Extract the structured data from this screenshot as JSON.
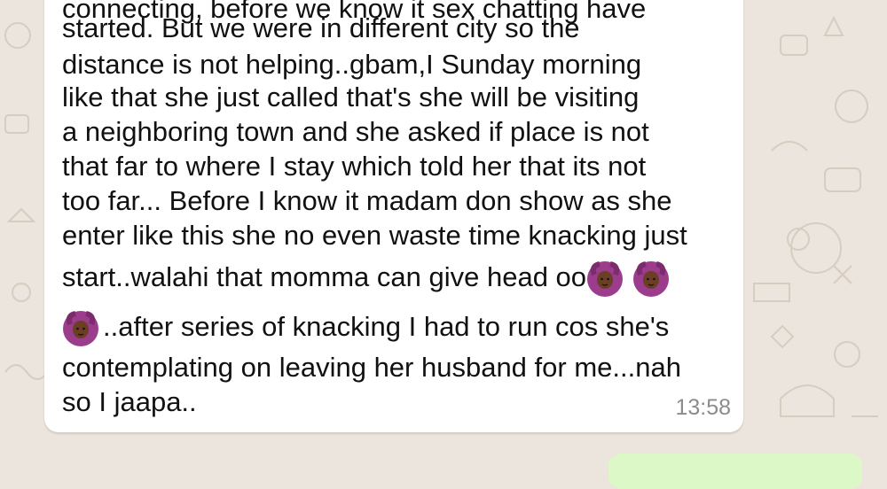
{
  "message": {
    "lines": [
      "connecting, before we know it sex chatting have",
      "started. But we were in different city so the",
      "distance is not helping..gbam,I Sunday morning",
      "like that she just called that's she will be visiting",
      "a neighboring town and she asked if place is not",
      "that far to where I stay which told her that its not",
      "too far... Before I know it madam don show as she",
      "enter like this she no even waste time knacking just",
      "start..walahi that momma can give head oo",
      "..after series of knacking I had to run cos she's",
      "contemplating on leaving her husband for me...nah",
      "so I jaapa.."
    ],
    "time": "13:58",
    "emoji_icon": "person-gesturing-ok-emoji"
  },
  "colors": {
    "wallpaper": "#ece5dd",
    "incoming_bubble": "#ffffff",
    "outgoing_bubble": "#dcf8c6",
    "timestamp": "#8c8c8c"
  }
}
